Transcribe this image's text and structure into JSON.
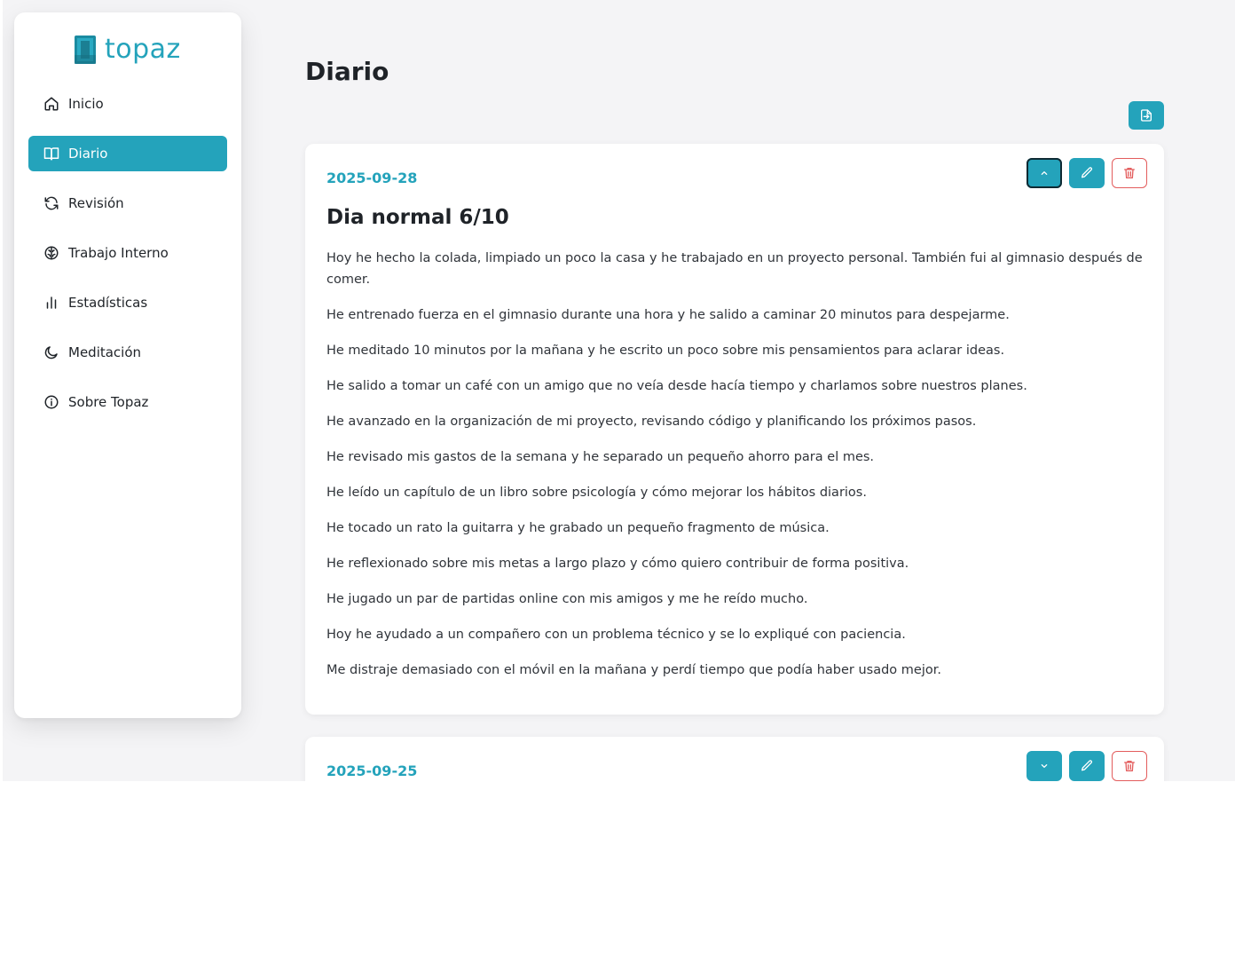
{
  "brand": {
    "name": "topaz",
    "color": "#24a3bb"
  },
  "nav": [
    {
      "label": "Inicio",
      "icon": "home-icon",
      "active": false
    },
    {
      "label": "Diario",
      "icon": "book-icon",
      "active": true
    },
    {
      "label": "Revisión",
      "icon": "refresh-icon",
      "active": false
    },
    {
      "label": "Trabajo Interno",
      "icon": "brain-icon",
      "active": false
    },
    {
      "label": "Estadísticas",
      "icon": "bar-chart-icon",
      "active": false
    },
    {
      "label": "Meditación",
      "icon": "moon-icon",
      "active": false
    },
    {
      "label": "Sobre Topaz",
      "icon": "info-icon",
      "active": false
    }
  ],
  "page": {
    "title": "Diario"
  },
  "entries": [
    {
      "date": "2025-09-28",
      "title": "Dia normal 6/10",
      "expanded": true,
      "paragraphs": [
        "Hoy he hecho la colada, limpiado un poco la casa y he trabajado en un proyecto personal. También fui al gimnasio después de comer.",
        "He entrenado fuerza en el gimnasio durante una hora y he salido a caminar 20 minutos para despejarme.",
        "He meditado 10 minutos por la mañana y he escrito un poco sobre mis pensamientos para aclarar ideas.",
        "He salido a tomar un café con un amigo que no veía desde hacía tiempo y charlamos sobre nuestros planes.",
        "He avanzado en la organización de mi proyecto, revisando código y planificando los próximos pasos.",
        "He revisado mis gastos de la semana y he separado un pequeño ahorro para el mes.",
        "He leído un capítulo de un libro sobre psicología y cómo mejorar los hábitos diarios.",
        "He tocado un rato la guitarra y he grabado un pequeño fragmento de música.",
        "He reflexionado sobre mis metas a largo plazo y cómo quiero contribuir de forma positiva.",
        "He jugado un par de partidas online con mis amigos y me he reído mucho.",
        "Hoy he ayudado a un compañero con un problema técnico y se lo expliqué con paciencia.",
        "Me distraje demasiado con el móvil en la mañana y perdí tiempo que podía haber usado mejor."
      ]
    },
    {
      "date": "2025-09-25",
      "expanded": false
    }
  ],
  "colors": {
    "accent": "#24a3bb",
    "danger": "#e35d5d",
    "background": "#f4f4f6"
  }
}
